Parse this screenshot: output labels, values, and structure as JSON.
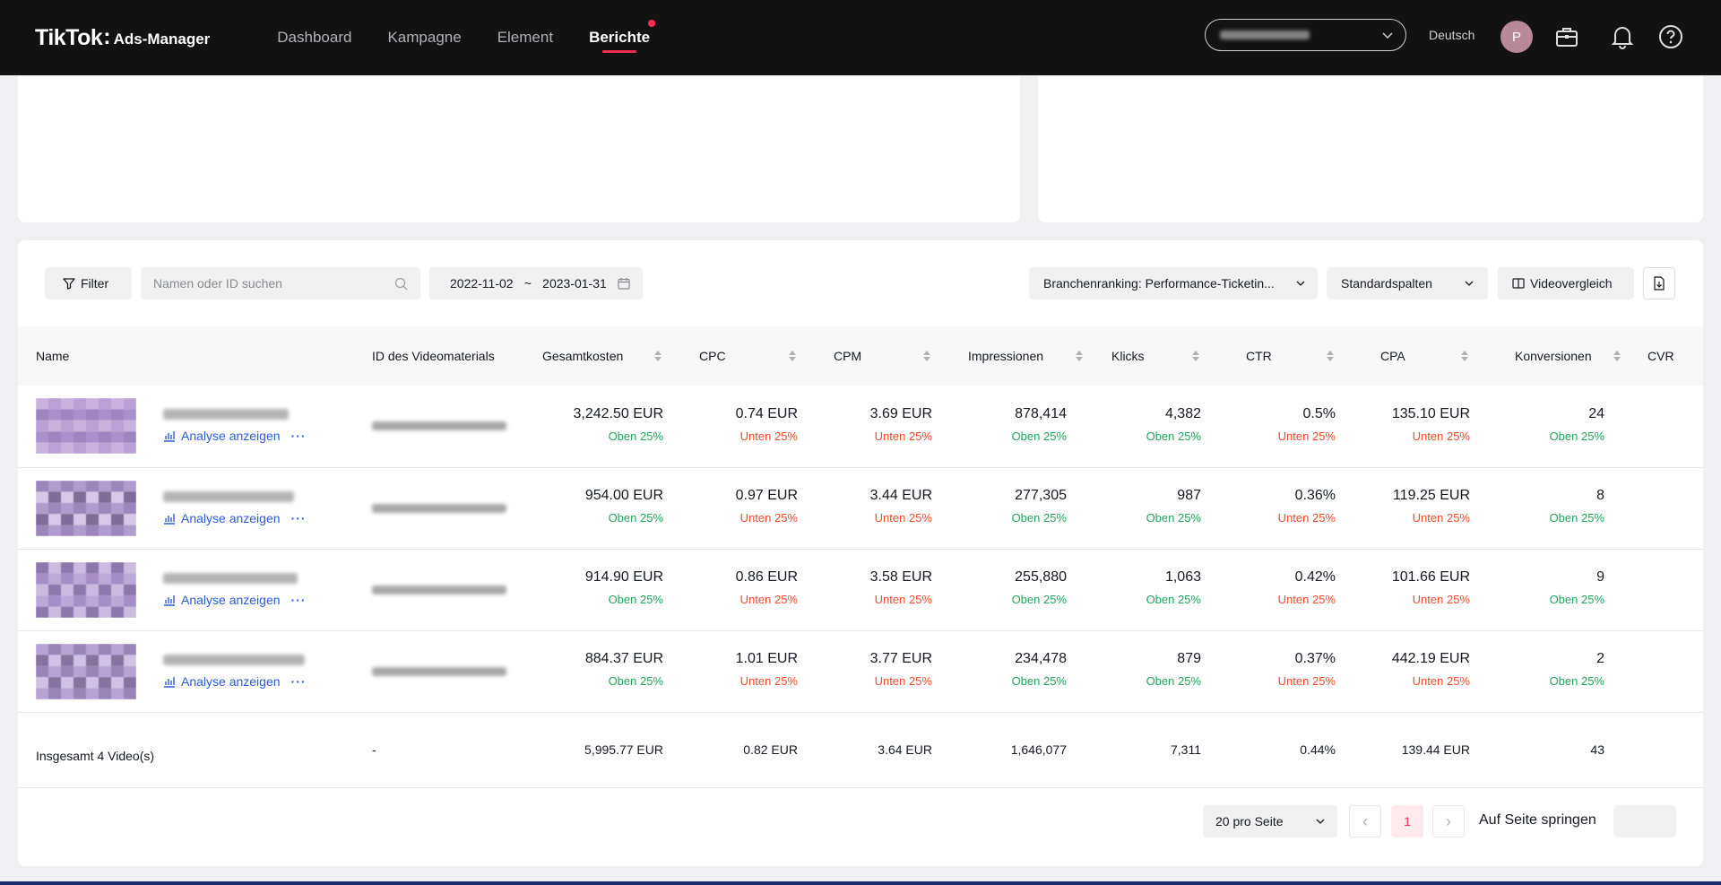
{
  "app": {
    "logo_main": "TikTok",
    "logo_colon": ":",
    "logo_sub": "Ads-Manager",
    "nav": [
      {
        "label": "Dashboard",
        "active": false
      },
      {
        "label": "Kampagne",
        "active": false
      },
      {
        "label": "Element",
        "active": false
      },
      {
        "label": "Berichte",
        "active": true
      }
    ],
    "language": "Deutsch",
    "avatar_initial": "P"
  },
  "toolbar": {
    "filter_label": "Filter",
    "search_placeholder": "Namen oder ID suchen",
    "date_start": "2022-11-02",
    "date_sep": "~",
    "date_end": "2023-01-31",
    "ranking_label": "Branchenranking: Performance-Ticketin...",
    "columns_label": "Standardspalten",
    "compare_label": "Videovergleich"
  },
  "table": {
    "headers": [
      "Name",
      "ID des Videomaterials",
      "Gesamtkosten",
      "CPC",
      "CPM",
      "Impressionen",
      "Klicks",
      "CTR",
      "CPA",
      "Konversionen",
      "CVR"
    ],
    "analyse_label": "Analyse anzeigen",
    "more_label": "···",
    "rows": [
      {
        "gesamtkosten": "3,242.50 EUR",
        "gesamtkosten_tag": "Oben 25%",
        "cpc": "0.74 EUR",
        "cpc_tag": "Unten 25%",
        "cpm": "3.69 EUR",
        "cpm_tag": "Unten 25%",
        "impressionen": "878,414",
        "impressionen_tag": "Oben 25%",
        "klicks": "4,382",
        "klicks_tag": "Oben 25%",
        "ctr": "0.5%",
        "ctr_tag": "Unten 25%",
        "cpa": "135.10 EUR",
        "cpa_tag": "Unten 25%",
        "konversionen": "24",
        "konversionen_tag": "Oben 25%"
      },
      {
        "gesamtkosten": "954.00 EUR",
        "gesamtkosten_tag": "Oben 25%",
        "cpc": "0.97 EUR",
        "cpc_tag": "Unten 25%",
        "cpm": "3.44 EUR",
        "cpm_tag": "Unten 25%",
        "impressionen": "277,305",
        "impressionen_tag": "Oben 25%",
        "klicks": "987",
        "klicks_tag": "Oben 25%",
        "ctr": "0.36%",
        "ctr_tag": "Unten 25%",
        "cpa": "119.25 EUR",
        "cpa_tag": "Unten 25%",
        "konversionen": "8",
        "konversionen_tag": "Oben 25%"
      },
      {
        "gesamtkosten": "914.90 EUR",
        "gesamtkosten_tag": "Oben 25%",
        "cpc": "0.86 EUR",
        "cpc_tag": "Unten 25%",
        "cpm": "3.58 EUR",
        "cpm_tag": "Unten 25%",
        "impressionen": "255,880",
        "impressionen_tag": "Oben 25%",
        "klicks": "1,063",
        "klicks_tag": "Oben 25%",
        "ctr": "0.42%",
        "ctr_tag": "Unten 25%",
        "cpa": "101.66 EUR",
        "cpa_tag": "Unten 25%",
        "konversionen": "9",
        "konversionen_tag": "Oben 25%"
      },
      {
        "gesamtkosten": "884.37 EUR",
        "gesamtkosten_tag": "Oben 25%",
        "cpc": "1.01 EUR",
        "cpc_tag": "Unten 25%",
        "cpm": "3.77 EUR",
        "cpm_tag": "Unten 25%",
        "impressionen": "234,478",
        "impressionen_tag": "Oben 25%",
        "klicks": "879",
        "klicks_tag": "Oben 25%",
        "ctr": "0.37%",
        "ctr_tag": "Unten 25%",
        "cpa": "442.19 EUR",
        "cpa_tag": "Unten 25%",
        "konversionen": "2",
        "konversionen_tag": "Oben 25%"
      }
    ],
    "total": {
      "label": "Insgesamt 4 Video(s)",
      "id": "-",
      "gesamtkosten": "5,995.77 EUR",
      "cpc": "0.82 EUR",
      "cpm": "3.64 EUR",
      "impressionen": "1,646,077",
      "klicks": "7,311",
      "ctr": "0.44%",
      "cpa": "139.44 EUR",
      "konversionen": "43"
    }
  },
  "pagination": {
    "page_size_label": "20 pro Seite",
    "current_page": "1",
    "prev": "‹",
    "next": "›",
    "jump_label": "Auf Seite springen"
  },
  "colors": {
    "accent": "#fe2c55",
    "positive": "#21a65a",
    "negative": "#f5492c",
    "link": "#2b5de0",
    "topbar": "#121212"
  }
}
